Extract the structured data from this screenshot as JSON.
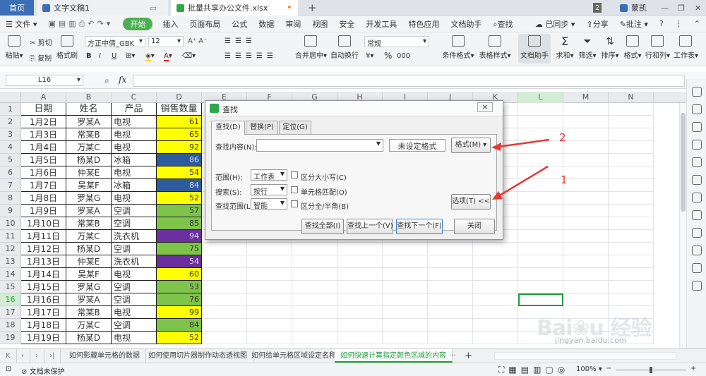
{
  "tabs": {
    "home": "首页",
    "doc": "文字文稿1",
    "xls": "批量共享办公文件.xlsx",
    "new": "+",
    "badge": "2",
    "user": "蒙凯"
  },
  "menu": {
    "file": "文件",
    "start": "开始",
    "items": [
      "插入",
      "页面布局",
      "公式",
      "数据",
      "审阅",
      "视图",
      "安全",
      "开发工具",
      "特色应用",
      "文档助手"
    ],
    "search": "查找",
    "sync": "已同步",
    "share": "分享",
    "comment": "批注",
    "help": "?"
  },
  "ribbon": {
    "paste": "粘贴",
    "cut": "剪切",
    "copy": "复制",
    "painter": "格式刷",
    "font": "方正中倩_GBK",
    "size": "12",
    "bold": "B",
    "italic": "I",
    "underline": "U",
    "merge": "合并居中",
    "wrap": "自动换行",
    "numfmt": "常规",
    "currency": "¥",
    "percent": "%",
    "thousand": "000",
    "cond": "条件格式",
    "tablestyle": "表格样式",
    "assist": "文档助手",
    "sum": "求和",
    "filter": "筛选",
    "sort": "排序",
    "format": "格式",
    "rowcol": "行和列",
    "sheet": "工作表"
  },
  "formula": {
    "cellref": "L16",
    "fx": "fx",
    "value": ""
  },
  "columns": [
    "A",
    "B",
    "C",
    "D",
    "E",
    "F",
    "G",
    "H",
    "I",
    "J",
    "K",
    "L",
    "M",
    "N"
  ],
  "rows": [
    "1",
    "2",
    "3",
    "4",
    "5",
    "6",
    "7",
    "8",
    "9",
    "10",
    "11",
    "12",
    "13",
    "14",
    "15",
    "16",
    "17",
    "18",
    "19"
  ],
  "headers": [
    "日期",
    "姓名",
    "产品",
    "销售数量"
  ],
  "data": [
    [
      "1月2日",
      "罗某A",
      "电视",
      "61",
      "#ffff00"
    ],
    [
      "1月3日",
      "常某B",
      "电视",
      "65",
      "#ffff00"
    ],
    [
      "1月4日",
      "万某C",
      "电视",
      "92",
      "#ffff00"
    ],
    [
      "1月5日",
      "杨某D",
      "冰箱",
      "86",
      "#2e5b9e"
    ],
    [
      "1月6日",
      "仲某E",
      "电视",
      "54",
      "#ffff00"
    ],
    [
      "1月7日",
      "吴某F",
      "冰箱",
      "84",
      "#2e5b9e"
    ],
    [
      "1月8日",
      "罗某G",
      "电视",
      "52",
      "#ffff00"
    ],
    [
      "1月9日",
      "罗某A",
      "空调",
      "57",
      "#7ec34a"
    ],
    [
      "1月10日",
      "常某B",
      "空调",
      "85",
      "#7ec34a"
    ],
    [
      "1月11日",
      "万某C",
      "洗衣机",
      "94",
      "#6b2fa0"
    ],
    [
      "1月12日",
      "杨某D",
      "空调",
      "75",
      "#7ec34a"
    ],
    [
      "1月13日",
      "仲某E",
      "洗衣机",
      "54",
      "#6b2fa0"
    ],
    [
      "1月14日",
      "吴某F",
      "电视",
      "60",
      "#ffff00"
    ],
    [
      "1月15日",
      "罗某G",
      "空调",
      "53",
      "#7ec34a"
    ],
    [
      "1月16日",
      "罗某A",
      "空调",
      "76",
      "#7ec34a"
    ],
    [
      "1月17日",
      "常某B",
      "电视",
      "99",
      "#ffff00"
    ],
    [
      "1月18日",
      "万某C",
      "空调",
      "84",
      "#7ec34a"
    ],
    [
      "1月19日",
      "杨某D",
      "电视",
      "52",
      "#ffff00"
    ]
  ],
  "sheets": [
    "如何影藏单元格的数据",
    "如何使用切片器制作动态透视图",
    "如何给单元格区域设定名称",
    "如何快速计算指定颜色区域的内容",
    "···",
    "+"
  ],
  "status": {
    "protect": "文档未保护",
    "zoom": "100%"
  },
  "dialog": {
    "title": "查找",
    "close": "×",
    "tabs": [
      "查找(D)",
      "替换(P)",
      "定位(G)"
    ],
    "find_label": "查找内容(N):",
    "no_format": "未设定格式",
    "format_btn": "格式(M)",
    "scope_label": "范围(H):",
    "scope_value": "工作表",
    "search_label": "搜索(S):",
    "search_value": "按行",
    "lookin_label": "查找范围(L):",
    "lookin_value": "智能",
    "case": "区分大小写(C)",
    "whole": "单元格匹配(O)",
    "width": "区分全/半角(B)",
    "options_btn": "选项(T) <<",
    "find_all": "查找全部(I)",
    "find_prev": "查找上一个(V)",
    "find_next": "查找下一个(F)",
    "close_btn": "关闭"
  },
  "annotations": {
    "one": "1",
    "two": "2"
  },
  "watermark": "jingyan.baidu.com"
}
